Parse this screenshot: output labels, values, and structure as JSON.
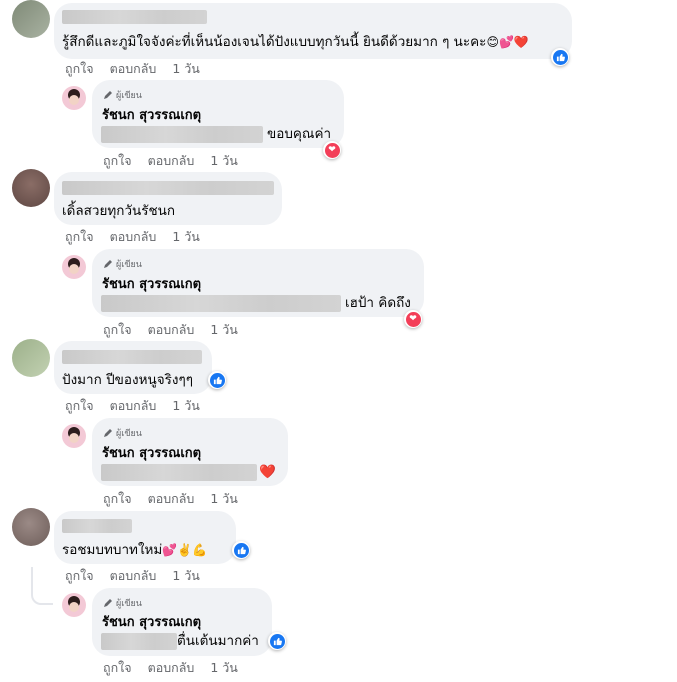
{
  "reply_author": {
    "badge": "ผู้เขียน",
    "name": "รัชนก สุวรรณเกตุ"
  },
  "actions": {
    "like": "ถูกใจ",
    "reply": "ตอบกลับ",
    "time": "1 วัน"
  },
  "comments": [
    {
      "text": "รู้สึกดีและภูมิใจจังค่ะที่เห็นน้องเจนได้ปังแบบทุกวันนี้ ยินดีด้วยมาก ๆ นะคะ",
      "emojis": "😊💕❤️",
      "reaction": "like",
      "reply": {
        "text": "ขอบคุณค่า",
        "emojis": "",
        "reaction": "love"
      }
    },
    {
      "text": "เดิ้ลสวยทุกวันรัชนก",
      "emojis": "",
      "reaction": "",
      "reply": {
        "text": "เฮป้า คิดถึง",
        "emojis": "",
        "reaction": "love"
      }
    },
    {
      "text": "ปังมาก ปีของหนูจริงๆๆ",
      "emojis": "",
      "reaction": "like",
      "reply": {
        "text": "",
        "emojis": "❤️",
        "reaction": ""
      }
    },
    {
      "text": "รอชมบทบาทใหม่",
      "emojis": "💕✌️💪",
      "reaction": "like",
      "reply": {
        "text": "ตื่นเต้นมากค่า",
        "emojis": "",
        "reaction": "like"
      }
    }
  ],
  "icons": {
    "like": "like-icon",
    "love": "love-icon",
    "pencil": "pencil-icon"
  },
  "colors": {
    "like": "#1877f2",
    "love": "#f33e58",
    "bubble": "#f0f2f5",
    "meta": "#65676b"
  }
}
